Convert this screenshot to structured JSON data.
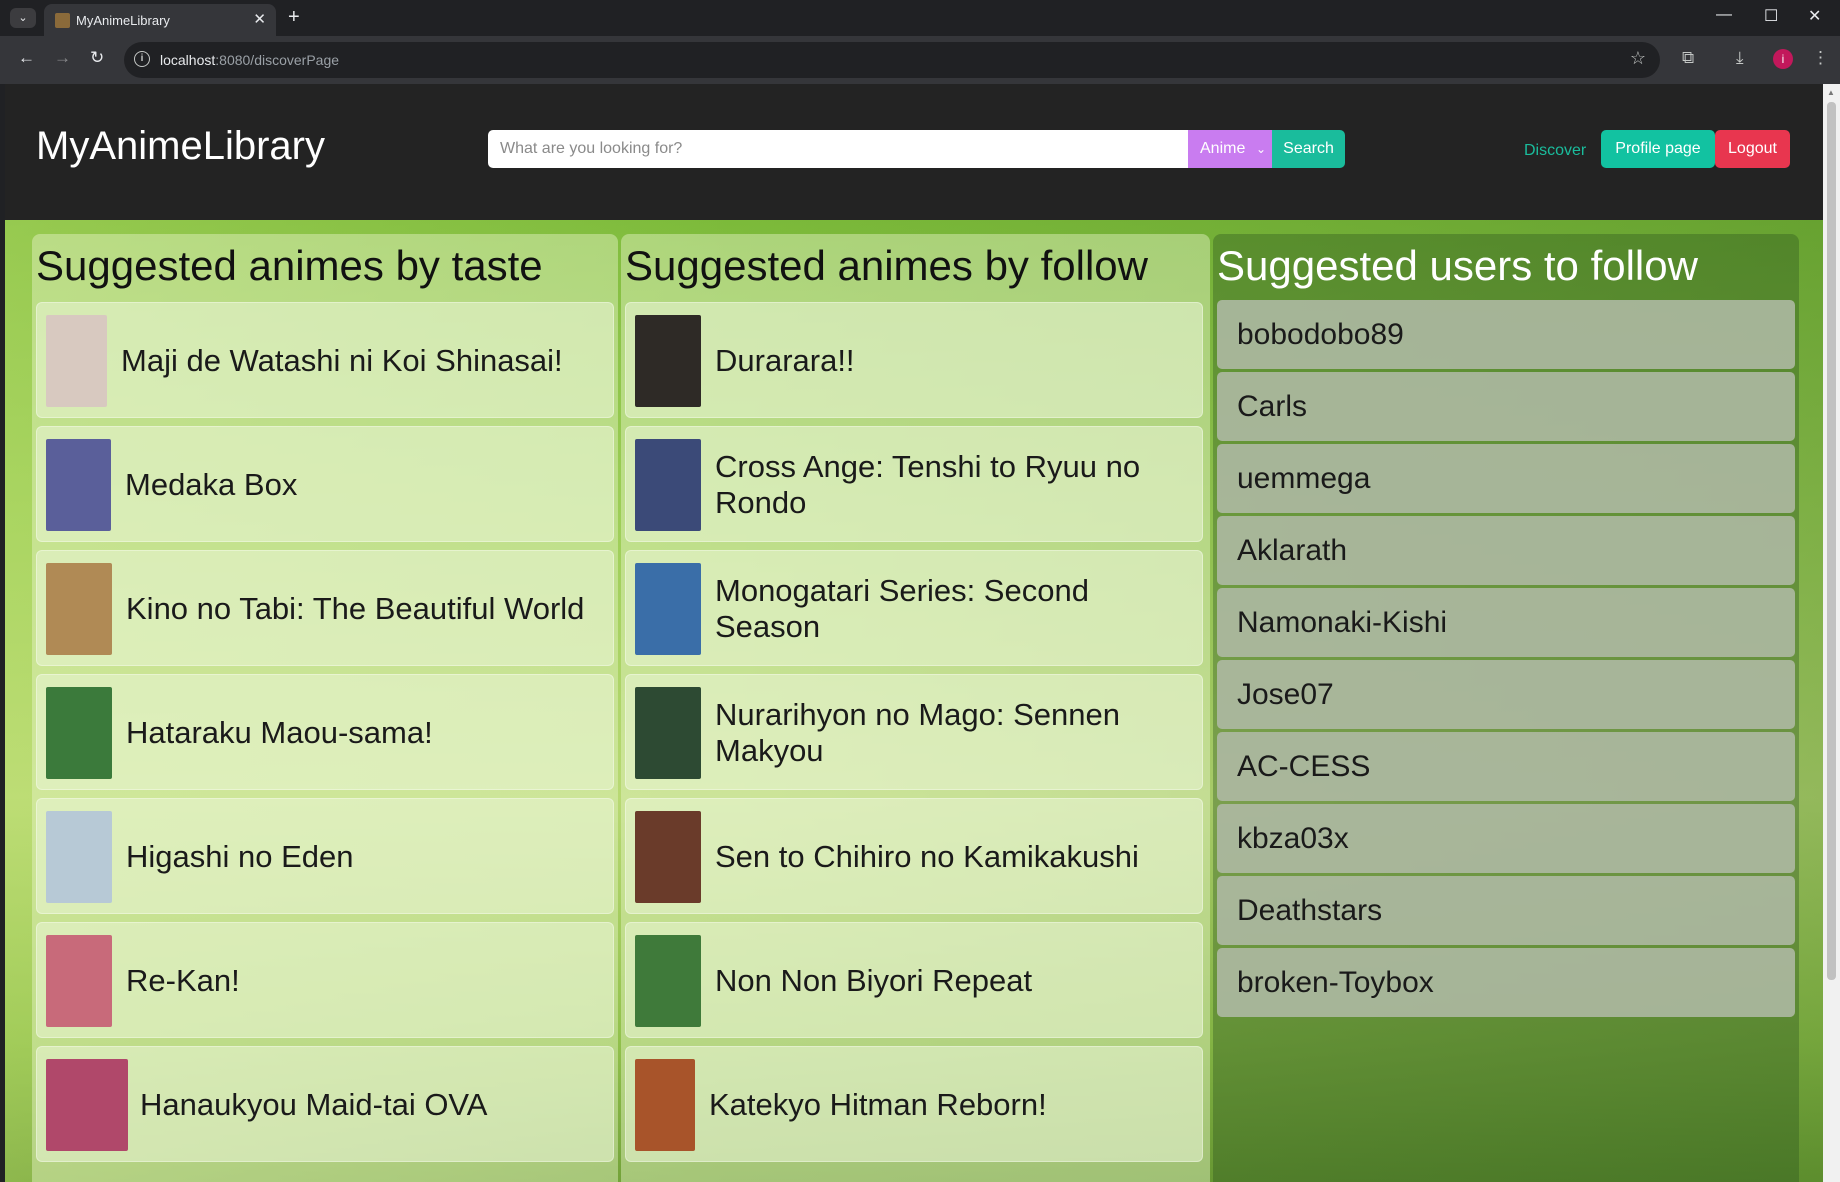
{
  "browser": {
    "tab_title": "MyAnimeLibrary",
    "url_host": "localhost",
    "url_rest": ":8080/discoverPage",
    "avatar_letter": "i"
  },
  "header": {
    "logo": "MyAnimeLibrary",
    "search_placeholder": "What are you looking for?",
    "search_type": "Anime",
    "search_button": "Search",
    "nav_discover": "Discover",
    "nav_profile": "Profile page",
    "nav_logout": "Logout"
  },
  "columns": {
    "taste": {
      "title": "Suggested animes by taste",
      "items": [
        {
          "title": "Maji de Watashi ni Koi Shinasai!",
          "poster_color": "#d8c9c0"
        },
        {
          "title": "Medaka Box",
          "poster_color": "#5a5f9a"
        },
        {
          "title": "Kino no Tabi: The Beautiful World",
          "poster_color": "#b08a55"
        },
        {
          "title": "Hataraku Maou-sama!",
          "poster_color": "#3b7a3b"
        },
        {
          "title": "Higashi no Eden",
          "poster_color": "#b7c9d6"
        },
        {
          "title": "Re-Kan!",
          "poster_color": "#c86a7a"
        },
        {
          "title": "Hanaukyou Maid-tai OVA",
          "poster_color": "#b0486a"
        }
      ]
    },
    "follow": {
      "title": "Suggested animes by follow",
      "items": [
        {
          "title": "Durarara!!",
          "poster_color": "#2e2a26"
        },
        {
          "title": "Cross Ange: Tenshi to Ryuu no Rondo",
          "poster_color": "#3b4a78"
        },
        {
          "title": "Monogatari Series: Second Season",
          "poster_color": "#3a6ea8"
        },
        {
          "title": "Nurarihyon no Mago: Sennen Makyou",
          "poster_color": "#2d4a33"
        },
        {
          "title": "Sen to Chihiro no Kamikakushi",
          "poster_color": "#6a3b2a"
        },
        {
          "title": "Non Non Biyori Repeat",
          "poster_color": "#3f7a3a"
        },
        {
          "title": "Katekyo Hitman Reborn!",
          "poster_color": "#a8542a"
        }
      ]
    },
    "users": {
      "title": "Suggested users to follow",
      "items": [
        "bobodobo89",
        "Carls",
        "uemmega",
        "Aklarath",
        "Namonaki-Kishi",
        "Jose07",
        "AC-CESS",
        "kbza03x",
        "Deathstars",
        "broken-Toybox"
      ]
    }
  }
}
